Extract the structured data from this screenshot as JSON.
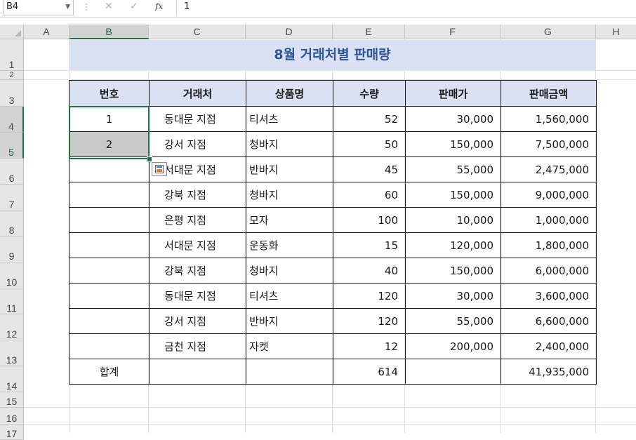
{
  "formula_bar": {
    "name_box": "B4",
    "cancel_icon": "✕",
    "enter_icon": "✓",
    "function_icon": "fx",
    "value": "1"
  },
  "columns": [
    "A",
    "B",
    "C",
    "D",
    "E",
    "F",
    "G",
    "H"
  ],
  "rows": [
    "1",
    "2",
    "3",
    "4",
    "5",
    "6",
    "7",
    "8",
    "9",
    "10",
    "11",
    "12",
    "13",
    "14",
    "15",
    "16",
    "17"
  ],
  "selection": {
    "active_cell": "B4",
    "range": "B4:B5",
    "selected_rows": [
      "4",
      "5"
    ],
    "selected_column": "B"
  },
  "sheet": {
    "title": "8월 거래처별 판매량",
    "headers": [
      "번호",
      "거래처",
      "상품명",
      "수량",
      "판매가",
      "판매금액"
    ],
    "rows": [
      [
        "1",
        "동대문 지점",
        "티셔츠",
        "52",
        "30,000",
        "1,560,000"
      ],
      [
        "2",
        "강서 지점",
        "청바지",
        "50",
        "150,000",
        "7,500,000"
      ],
      [
        "",
        "서대문 지점",
        "반바지",
        "45",
        "55,000",
        "2,475,000"
      ],
      [
        "",
        "강북 지점",
        "청바지",
        "60",
        "150,000",
        "9,000,000"
      ],
      [
        "",
        "은평 지점",
        "모자",
        "100",
        "10,000",
        "1,000,000"
      ],
      [
        "",
        "서대문 지점",
        "운동화",
        "15",
        "120,000",
        "1,800,000"
      ],
      [
        "",
        "강북 지점",
        "청바지",
        "40",
        "150,000",
        "6,000,000"
      ],
      [
        "",
        "동대문 지점",
        "티셔츠",
        "120",
        "30,000",
        "3,600,000"
      ],
      [
        "",
        "강서 지점",
        "반바지",
        "120",
        "55,000",
        "6,600,000"
      ],
      [
        "",
        "금천 지점",
        "자켓",
        "12",
        "200,000",
        "2,400,000"
      ]
    ],
    "total": {
      "label": "합계",
      "quantity": "614",
      "amount": "41,935,000"
    }
  },
  "autofill_options_icon": "autofill-options-icon",
  "colors": {
    "accent": "#217346",
    "header_fill": "#d9e1f2",
    "title_text": "#2f5597",
    "selected_fill": "#c9c9c9"
  }
}
